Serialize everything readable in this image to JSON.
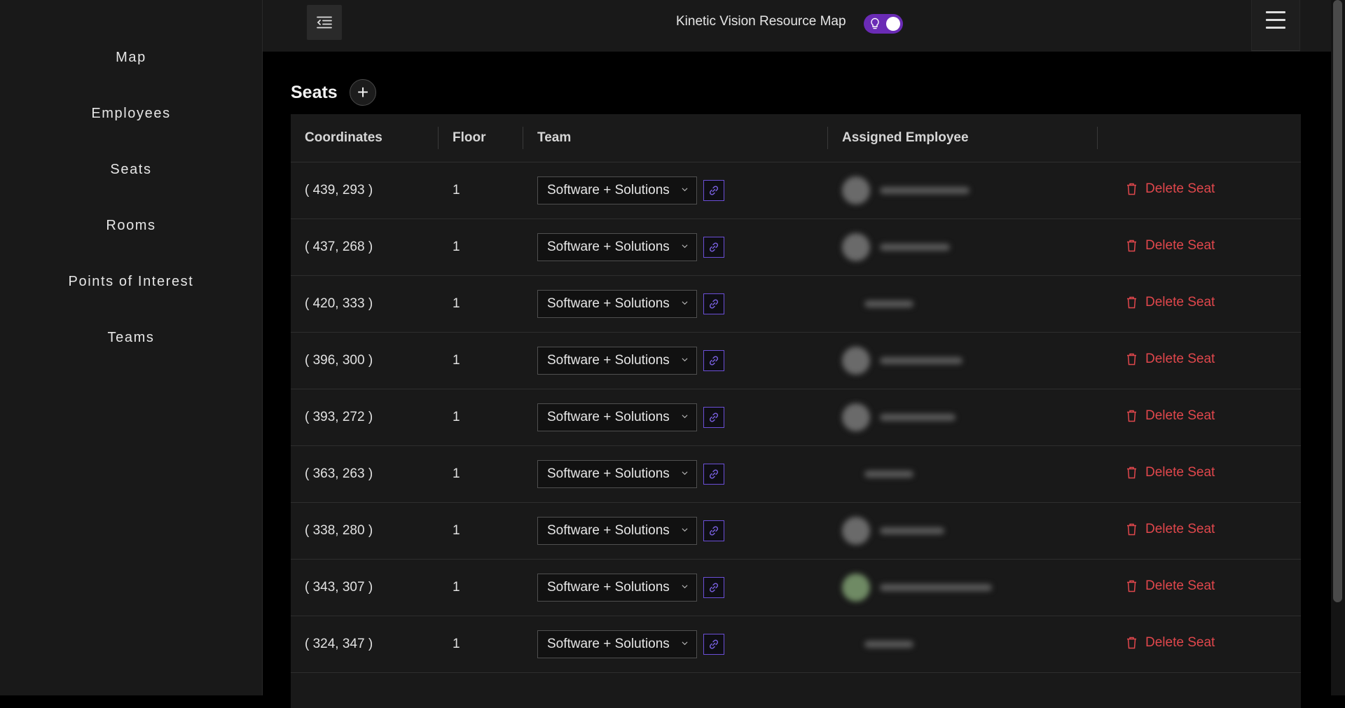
{
  "sidebar": {
    "items": [
      {
        "label": "Map"
      },
      {
        "label": "Employees"
      },
      {
        "label": "Seats"
      },
      {
        "label": "Rooms"
      },
      {
        "label": "Points of Interest"
      },
      {
        "label": "Teams"
      }
    ]
  },
  "header": {
    "title": "Kinetic Vision Resource Map",
    "theme_toggle_on": true,
    "accent_color": "#6a2bb5"
  },
  "page": {
    "title": "Seats",
    "add_label": "+"
  },
  "table": {
    "columns": [
      "Coordinates",
      "Floor",
      "Team",
      "Assigned Employee",
      ""
    ],
    "delete_label": "Delete Seat",
    "delete_color": "#e0474c",
    "rows": [
      {
        "coordinates": "( 439, 293 )",
        "floor": "1",
        "team": "Software + Solutions"
      },
      {
        "coordinates": "( 437, 268 )",
        "floor": "1",
        "team": "Software + Solutions"
      },
      {
        "coordinates": "( 420, 333 )",
        "floor": "1",
        "team": "Software + Solutions"
      },
      {
        "coordinates": "( 396, 300 )",
        "floor": "1",
        "team": "Software + Solutions"
      },
      {
        "coordinates": "( 393, 272 )",
        "floor": "1",
        "team": "Software + Solutions"
      },
      {
        "coordinates": "( 363, 263 )",
        "floor": "1",
        "team": "Software + Solutions"
      },
      {
        "coordinates": "( 338, 280 )",
        "floor": "1",
        "team": "Software + Solutions"
      },
      {
        "coordinates": "( 343, 307 )",
        "floor": "1",
        "team": "Software + Solutions"
      },
      {
        "coordinates": "( 324, 347 )",
        "floor": "1",
        "team": "Software + Solutions"
      }
    ]
  }
}
